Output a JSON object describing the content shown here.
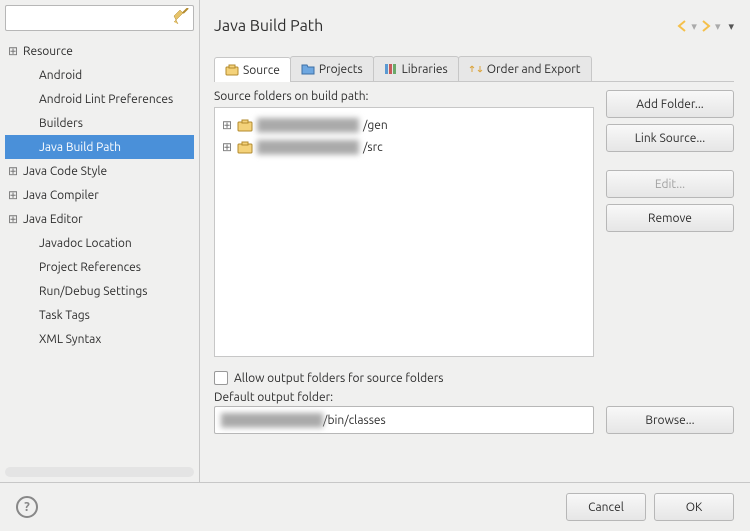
{
  "page_title": "Java Build Path",
  "filter": {
    "placeholder": ""
  },
  "tree": [
    {
      "label": "Resource",
      "expandable": true,
      "indent": 0
    },
    {
      "label": "Android",
      "expandable": false,
      "indent": 1
    },
    {
      "label": "Android Lint Preferences",
      "expandable": false,
      "indent": 1
    },
    {
      "label": "Builders",
      "expandable": false,
      "indent": 1
    },
    {
      "label": "Java Build Path",
      "expandable": false,
      "indent": 1,
      "selected": true
    },
    {
      "label": "Java Code Style",
      "expandable": true,
      "indent": 0
    },
    {
      "label": "Java Compiler",
      "expandable": true,
      "indent": 0
    },
    {
      "label": "Java Editor",
      "expandable": true,
      "indent": 0
    },
    {
      "label": "Javadoc Location",
      "expandable": false,
      "indent": 1
    },
    {
      "label": "Project References",
      "expandable": false,
      "indent": 1
    },
    {
      "label": "Run/Debug Settings",
      "expandable": false,
      "indent": 1
    },
    {
      "label": "Task Tags",
      "expandable": false,
      "indent": 1
    },
    {
      "label": "XML Syntax",
      "expandable": false,
      "indent": 1
    }
  ],
  "tabs": {
    "source": "Source",
    "projects": "Projects",
    "libraries": "Libraries",
    "order": "Order and Export"
  },
  "source_section": {
    "label": "Source folders on build path:",
    "items": [
      {
        "suffix": "/gen"
      },
      {
        "suffix": "/src"
      }
    ]
  },
  "buttons": {
    "add_folder": "Add Folder...",
    "link_source": "Link Source...",
    "edit": "Edit...",
    "remove": "Remove",
    "browse": "Browse..."
  },
  "allow_output": {
    "label": "Allow output folders for source folders",
    "checked": false
  },
  "default_output": {
    "label": "Default output folder:",
    "suffix": "/bin/classes"
  },
  "footer": {
    "cancel": "Cancel",
    "ok": "OK"
  }
}
